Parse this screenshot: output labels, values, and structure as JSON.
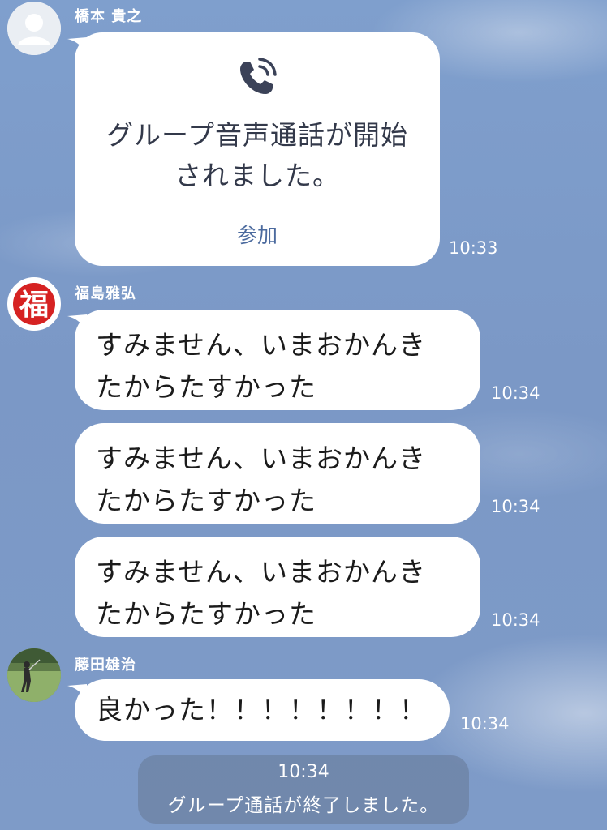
{
  "messages": {
    "m1": {
      "sender": "橋本 貴之",
      "call_text": "グループ音声通話が開始\nされました。",
      "join_label": "参加",
      "time": "10:33"
    },
    "m2": {
      "sender": "福島雅弘",
      "avatar_char": "福",
      "text": "すみません、いまおかんき\nたからたすかった",
      "time": "10:34"
    },
    "m3": {
      "text": "すみません、いまおかんき\nたからたすかった",
      "time": "10:34"
    },
    "m4": {
      "text": "すみません、いまおかんき\nたからたすかった",
      "time": "10:34"
    },
    "m5": {
      "sender": "藤田雄治",
      "text": "良かった！！！！！！！！",
      "time": "10:34"
    }
  },
  "system": {
    "time": "10:34",
    "message": "グループ通話が終了しました。"
  },
  "colors": {
    "background": "#7d9bc9",
    "bubble": "#ffffff",
    "join_link": "#4b6a9e",
    "fuku_red": "#d62222"
  },
  "icons": {
    "call": "phone-call-icon",
    "default_avatar": "default-user-icon"
  }
}
